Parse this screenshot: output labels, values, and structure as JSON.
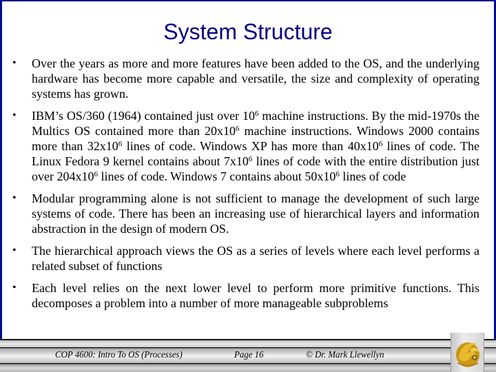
{
  "slide": {
    "title": "System Structure",
    "bullets": [
      {
        "parts": [
          "Over the years as more and more features have been added to the OS, and the underlying hardware has become more capable and versatile, the size and complexity of operating systems has grown."
        ]
      },
      {
        "parts": [
          "IBM’s OS/360 (1964) contained just over 10",
          "6",
          " machine instructions. By the mid-1970s the Multics OS contained more than 20x10",
          "6",
          " machine instructions.  Windows 2000 contains more than 32x10",
          "6",
          " lines of code.  Windows XP has more than 40x10",
          "6",
          " lines of code.   The Linux Fedora 9 kernel contains about 7x10",
          "6",
          " lines of code with the entire distribution just over 204x10",
          "6",
          " lines of code.  Windows 7 contains about 50x10",
          "6",
          " lines of code"
        ]
      },
      {
        "parts": [
          "Modular programming alone is not sufficient to manage the development of such large systems of code.  There has been an increasing use of hierarchical layers and information abstraction in the design of modern OS."
        ]
      },
      {
        "parts": [
          "The hierarchical approach views the OS as a series of levels where each level performs a related subset of functions"
        ]
      },
      {
        "parts": [
          "Each level relies on the next lower level to perform more primitive functions.  This decomposes a problem into a number of more manageable subproblems"
        ]
      }
    ],
    "bullet_glyph": "•"
  },
  "footer": {
    "course": "COP 4600: Intro To OS  (Processes)",
    "page": "Page 16",
    "author": "© Dr. Mark Llewellyn",
    "logo_icon": "pegasus-logo-icon"
  },
  "colors": {
    "title": "#000080",
    "frame_border": "#000c8a",
    "logo_gold": "#d4a017"
  }
}
